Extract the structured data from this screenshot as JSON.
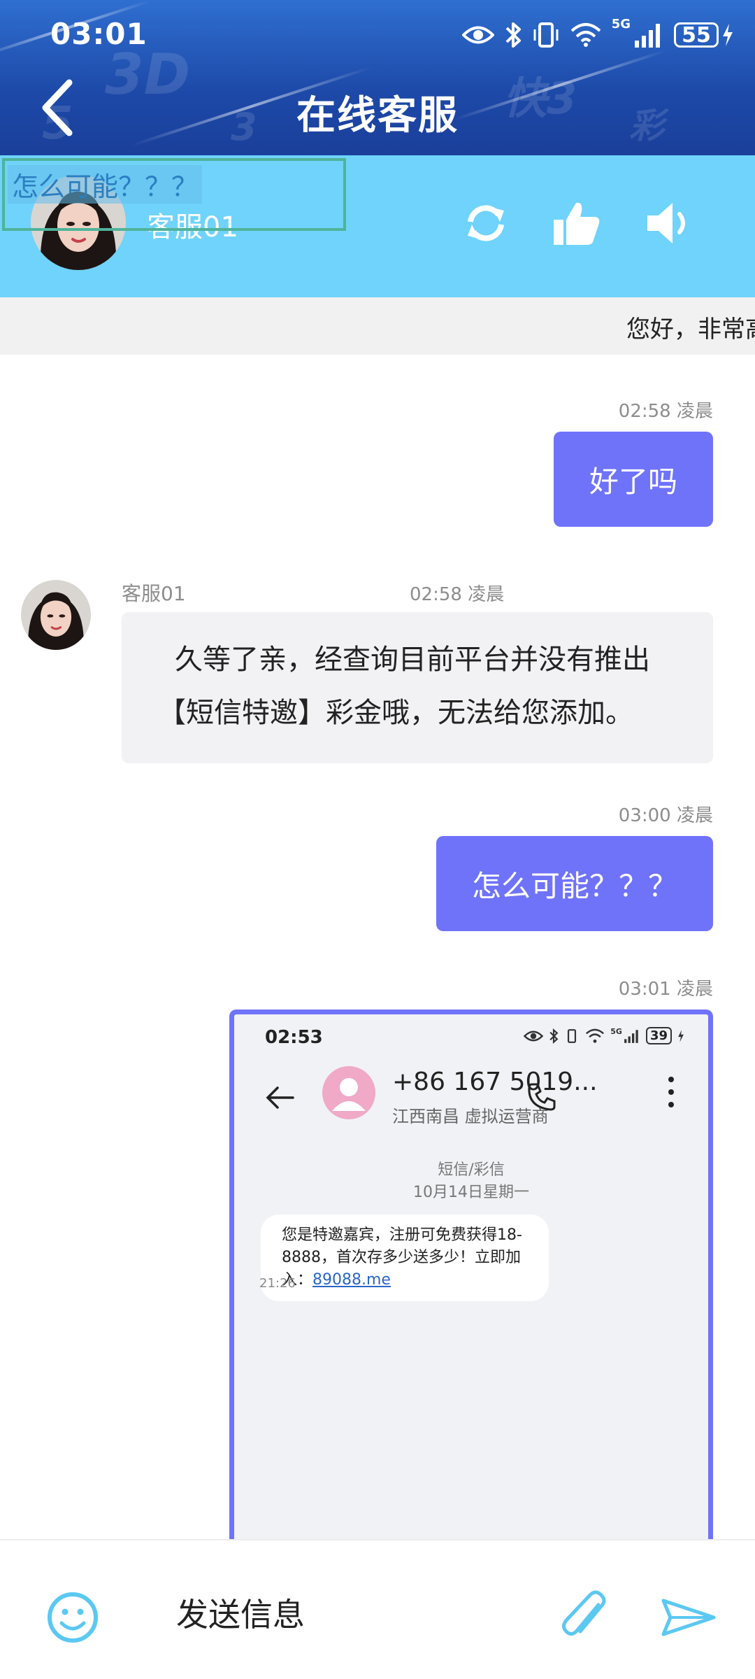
{
  "status_bar": {
    "time": "03:01",
    "network": "5G",
    "battery": "55"
  },
  "header": {
    "title": "在线客服"
  },
  "agent": {
    "name": "客服01",
    "actions": [
      "refresh-icon",
      "thumbs-up-icon",
      "speaker-icon"
    ]
  },
  "quote_overlay": {
    "text": "怎么可能？？？"
  },
  "marquee": {
    "text": "您好，非常高"
  },
  "messages": [
    {
      "direction": "out",
      "time": "02:58 凌晨",
      "text": "好了吗"
    },
    {
      "direction": "in",
      "sender": "客服01",
      "time": "02:58 凌晨",
      "text_line1": "久等了亲，经查询目前平台并没有推出",
      "text_line2": "【短信特邀】彩金哦，无法给您添加。"
    },
    {
      "direction": "out",
      "time": "03:00 凌晨",
      "text": "怎么可能？？？"
    },
    {
      "direction": "out",
      "time": "03:01 凌晨",
      "type": "image"
    }
  ],
  "screenshot": {
    "time": "02:53",
    "battery": "39",
    "network": "5G",
    "number": "+86 167 5019...",
    "location": "江西南昌 虚拟运营商",
    "msg_type": "短信/彩信",
    "date": "10月14日星期一",
    "sms_text": "您是特邀嘉宾，注册可免费获得18-8888，首次存多少送多少！立即加入：",
    "sms_link": "89088.me",
    "sms_time": "21:26"
  },
  "input": {
    "placeholder": "发送信息"
  },
  "colors": {
    "header": "#1d49a8",
    "agent_bar": "#6fd3fb",
    "outgoing_bubble": "#6f73fa",
    "incoming_bubble": "#f2f2f4",
    "icon_accent": "#5bc8f2"
  }
}
